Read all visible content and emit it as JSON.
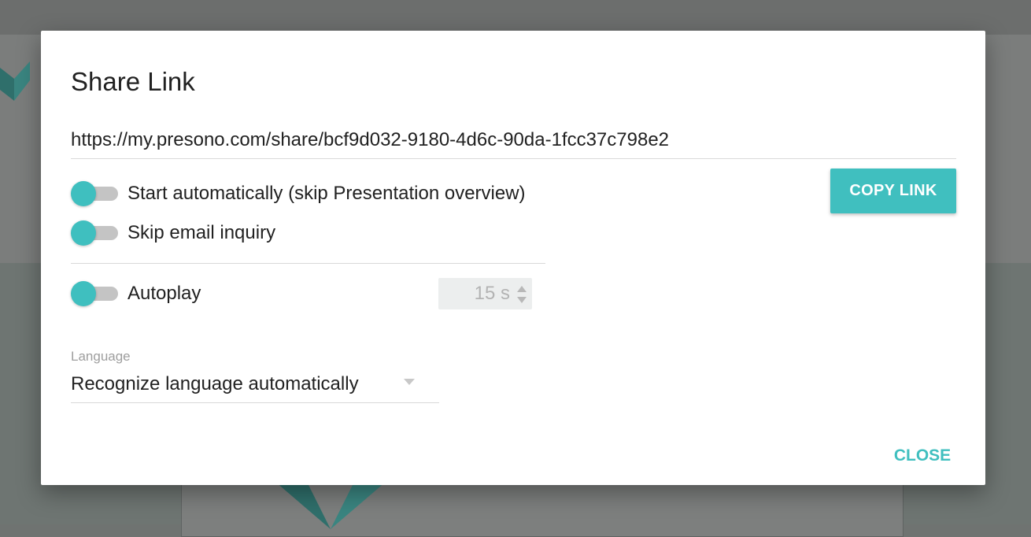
{
  "dialog": {
    "title": "Share Link",
    "share_url": "https://my.presono.com/share/bcf9d032-9180-4d6c-90da-1fcc37c798e2",
    "copy_button_label": "COPY LINK",
    "close_button_label": "CLOSE"
  },
  "options": {
    "start_automatically": {
      "label": "Start automatically (skip Presentation overview)"
    },
    "skip_email": {
      "label": "Skip email inquiry"
    },
    "autoplay": {
      "label": "Autoplay",
      "interval_value": "15 s"
    }
  },
  "language": {
    "label": "Language",
    "selected": "Recognize language automatically"
  },
  "colors": {
    "accent": "#40bfbf",
    "toggle_track": "#c4c4c4",
    "text": "#212121",
    "overlay": "#6f7371"
  },
  "icons": {
    "brand_logo": "presono-logo",
    "stepper": "up-down-arrows-icon",
    "dropdown": "caret-down-icon"
  }
}
